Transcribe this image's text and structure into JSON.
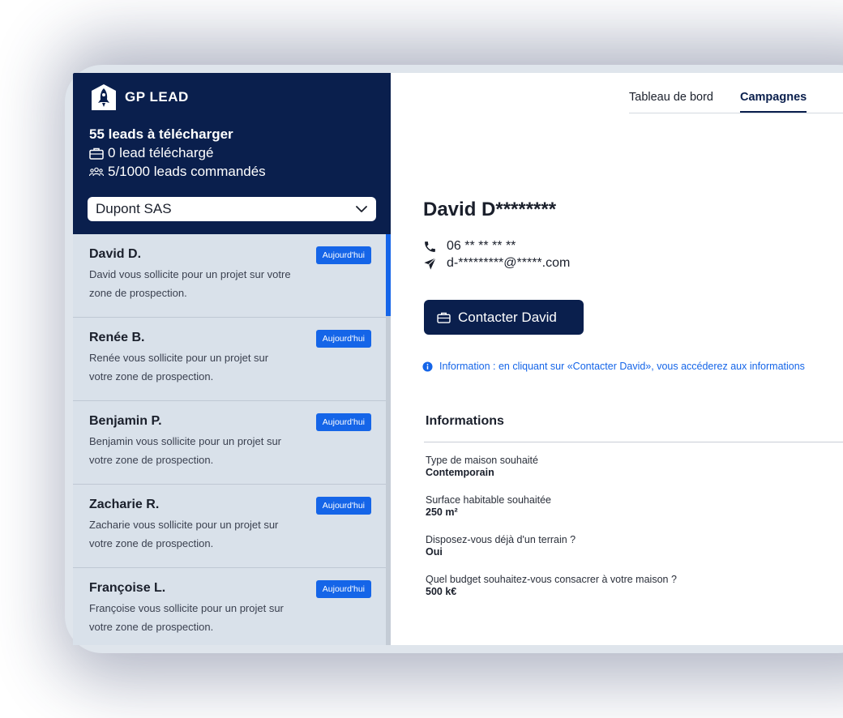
{
  "brand": {
    "name": "GP LEAD"
  },
  "stats": {
    "to_download": "55 leads à télécharger",
    "downloaded": "0 lead téléchargé",
    "ordered": "5/1000 leads commandés"
  },
  "company_select": {
    "value": "Dupont SAS"
  },
  "leads": [
    {
      "name": "David D.",
      "desc": "David vous sollicite pour un projet sur votre zone de prospection.",
      "badge": "Aujourd'hui"
    },
    {
      "name": "Renée B.",
      "desc": "Renée vous sollicite pour un projet sur votre zone de prospection.",
      "badge": "Aujourd'hui"
    },
    {
      "name": "Benjamin P.",
      "desc": "Benjamin vous sollicite pour un projet sur votre zone de prospection.",
      "badge": "Aujourd'hui"
    },
    {
      "name": "Zacharie R.",
      "desc": "Zacharie vous sollicite pour un projet sur votre zone de prospection.",
      "badge": "Aujourd'hui"
    },
    {
      "name": "Françoise L.",
      "desc": "Françoise vous sollicite pour un projet sur votre zone de prospection.",
      "badge": "Aujourd'hui"
    }
  ],
  "nav": {
    "tabs": [
      {
        "label": "Tableau de bord"
      },
      {
        "label": "Campagnes"
      }
    ],
    "active": "Campagnes"
  },
  "contact": {
    "name": "David D********",
    "phone": "06 ** ** ** **",
    "email": "d-*********@*****.com",
    "button_label": "Contacter David",
    "note": "Information : en cliquant sur «Contacter David», vous accéderez aux informations"
  },
  "informations": {
    "title": "Informations",
    "fields": [
      {
        "label": "Type de maison souhaité",
        "value": "Contemporain"
      },
      {
        "label": "Surface habitable souhaitée",
        "value": "250 m²"
      },
      {
        "label": "Disposez-vous déjà d'un terrain ?",
        "value": "Oui"
      },
      {
        "label": "Quel budget souhaitez-vous consacrer à votre maison ?",
        "value": "500 k€"
      }
    ]
  },
  "colors": {
    "navy": "#0a1f4d",
    "accent": "#1565e8",
    "sidebar": "#d9e1ea"
  },
  "icons": [
    "rocket-logo-icon",
    "briefcase-icon",
    "users-icon",
    "chevron-down-icon",
    "phone-icon",
    "send-icon",
    "info-icon"
  ]
}
